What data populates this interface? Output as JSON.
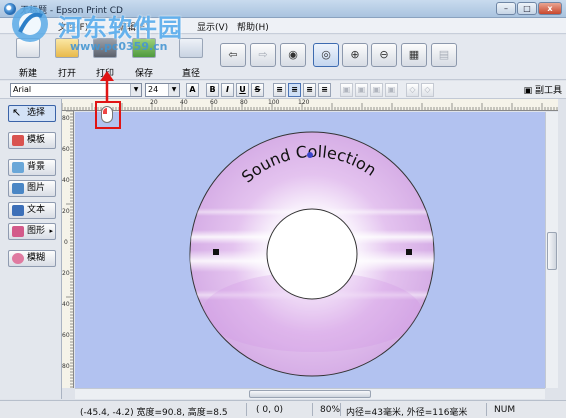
{
  "window": {
    "title": "无标题 - Epson Print CD",
    "min_label": "–",
    "max_label": "□",
    "close_label": "x"
  },
  "menu": [
    "文件(F)",
    "编辑(E)",
    "显示(V)",
    "帮助(H)"
  ],
  "watermark": {
    "text": "河东软件园",
    "url": "www.pc0359.cn"
  },
  "toolbar": {
    "new_label": "新建",
    "open_label": "打开",
    "print_label": "打印",
    "save_label": "保存",
    "straight_label": "直径"
  },
  "fontbar": {
    "font_value": "Arial",
    "size_value": "24",
    "underline_label": "U",
    "bold_label": "B",
    "italic_label": "I",
    "strike_label": "S",
    "color_label": "A",
    "sub_tool_label": "副工具"
  },
  "left_panel": {
    "items": [
      {
        "label": "选择",
        "icon": "arrow-icon"
      },
      {
        "label": "模板",
        "icon": "template-icon"
      },
      {
        "label": "背景",
        "icon": "background-icon"
      },
      {
        "label": "图片",
        "icon": "picture-icon"
      },
      {
        "label": "文本",
        "icon": "text-icon"
      },
      {
        "label": "图形",
        "icon": "shape-icon"
      },
      {
        "label": "模糊",
        "icon": "blur-icon"
      }
    ]
  },
  "ruler": {
    "top": [
      "20",
      "40",
      "60",
      "80",
      "100",
      "120"
    ],
    "left": [
      "80",
      "60",
      "40",
      "20",
      "0",
      "20",
      "40",
      "60",
      "80"
    ]
  },
  "disc": {
    "label_text": "Sound Collection",
    "colors": {
      "canvas": "#b2c2f0",
      "disc": "#e3c6ee",
      "accent": "#c58ce0"
    }
  },
  "status": {
    "position": "(-45.4, -4.2) 宽度=90.8, 高度=8.5",
    "cursor": "(   0,    0)",
    "zoom": "80%",
    "diameter": "内径=43毫米, 外径=116毫米",
    "num": "NUM"
  }
}
